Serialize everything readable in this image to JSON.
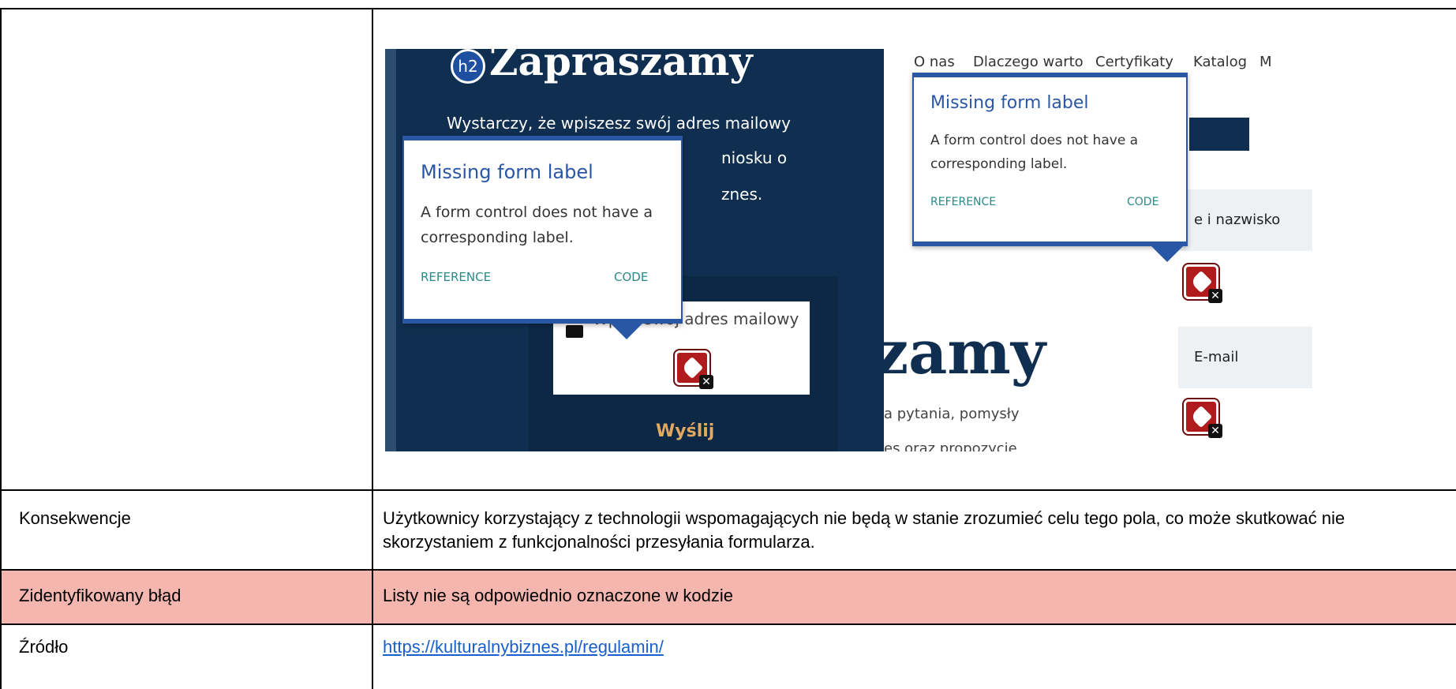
{
  "rows": [
    {
      "label": "",
      "text": ""
    },
    {
      "label": "Konsekwencje",
      "text": "Użytkownicy korzystający z technologii wspomagających nie będą w stanie zrozumieć celu tego pola, co może skutkować nie skorzystaniem z funkcjonalności przesyłania formularza."
    },
    {
      "label": "Zidentyfikowany błąd",
      "text": "Listy nie są odpowiednio oznaczone w kodzie"
    },
    {
      "label": "Źródło",
      "text": "https://kulturalnybiznes.pl/regulamin/"
    }
  ],
  "colors": {
    "highlight_row": "#f4b6ae",
    "link": "#1a5fd0",
    "popup_accent": "#2a56a6",
    "navy": "#102f50"
  },
  "screenshot": {
    "badge": "h2",
    "title": "Zapraszamy",
    "lines": [
      "Wystarczy, że wpiszesz swój adres mailowy",
      "niosku o",
      "znes."
    ],
    "email_placeholder": "Wpisz swój adres mailowy",
    "send_button": "Wyślij",
    "popup": {
      "title": "Missing form label",
      "body_line1": "A form control does not have a",
      "body_line2": "corresponding label.",
      "reference": "REFERENCE",
      "code": "CODE"
    },
    "nav": [
      "O nas",
      "Dlaczego warto",
      "Certyfikaty",
      "Katalog",
      "M"
    ],
    "fields": [
      "e i nazwisko",
      "E-mail"
    ],
    "right_title": "zamy",
    "right_lines": [
      "a pytania, pomysły",
      "es oraz propozycje"
    ]
  }
}
